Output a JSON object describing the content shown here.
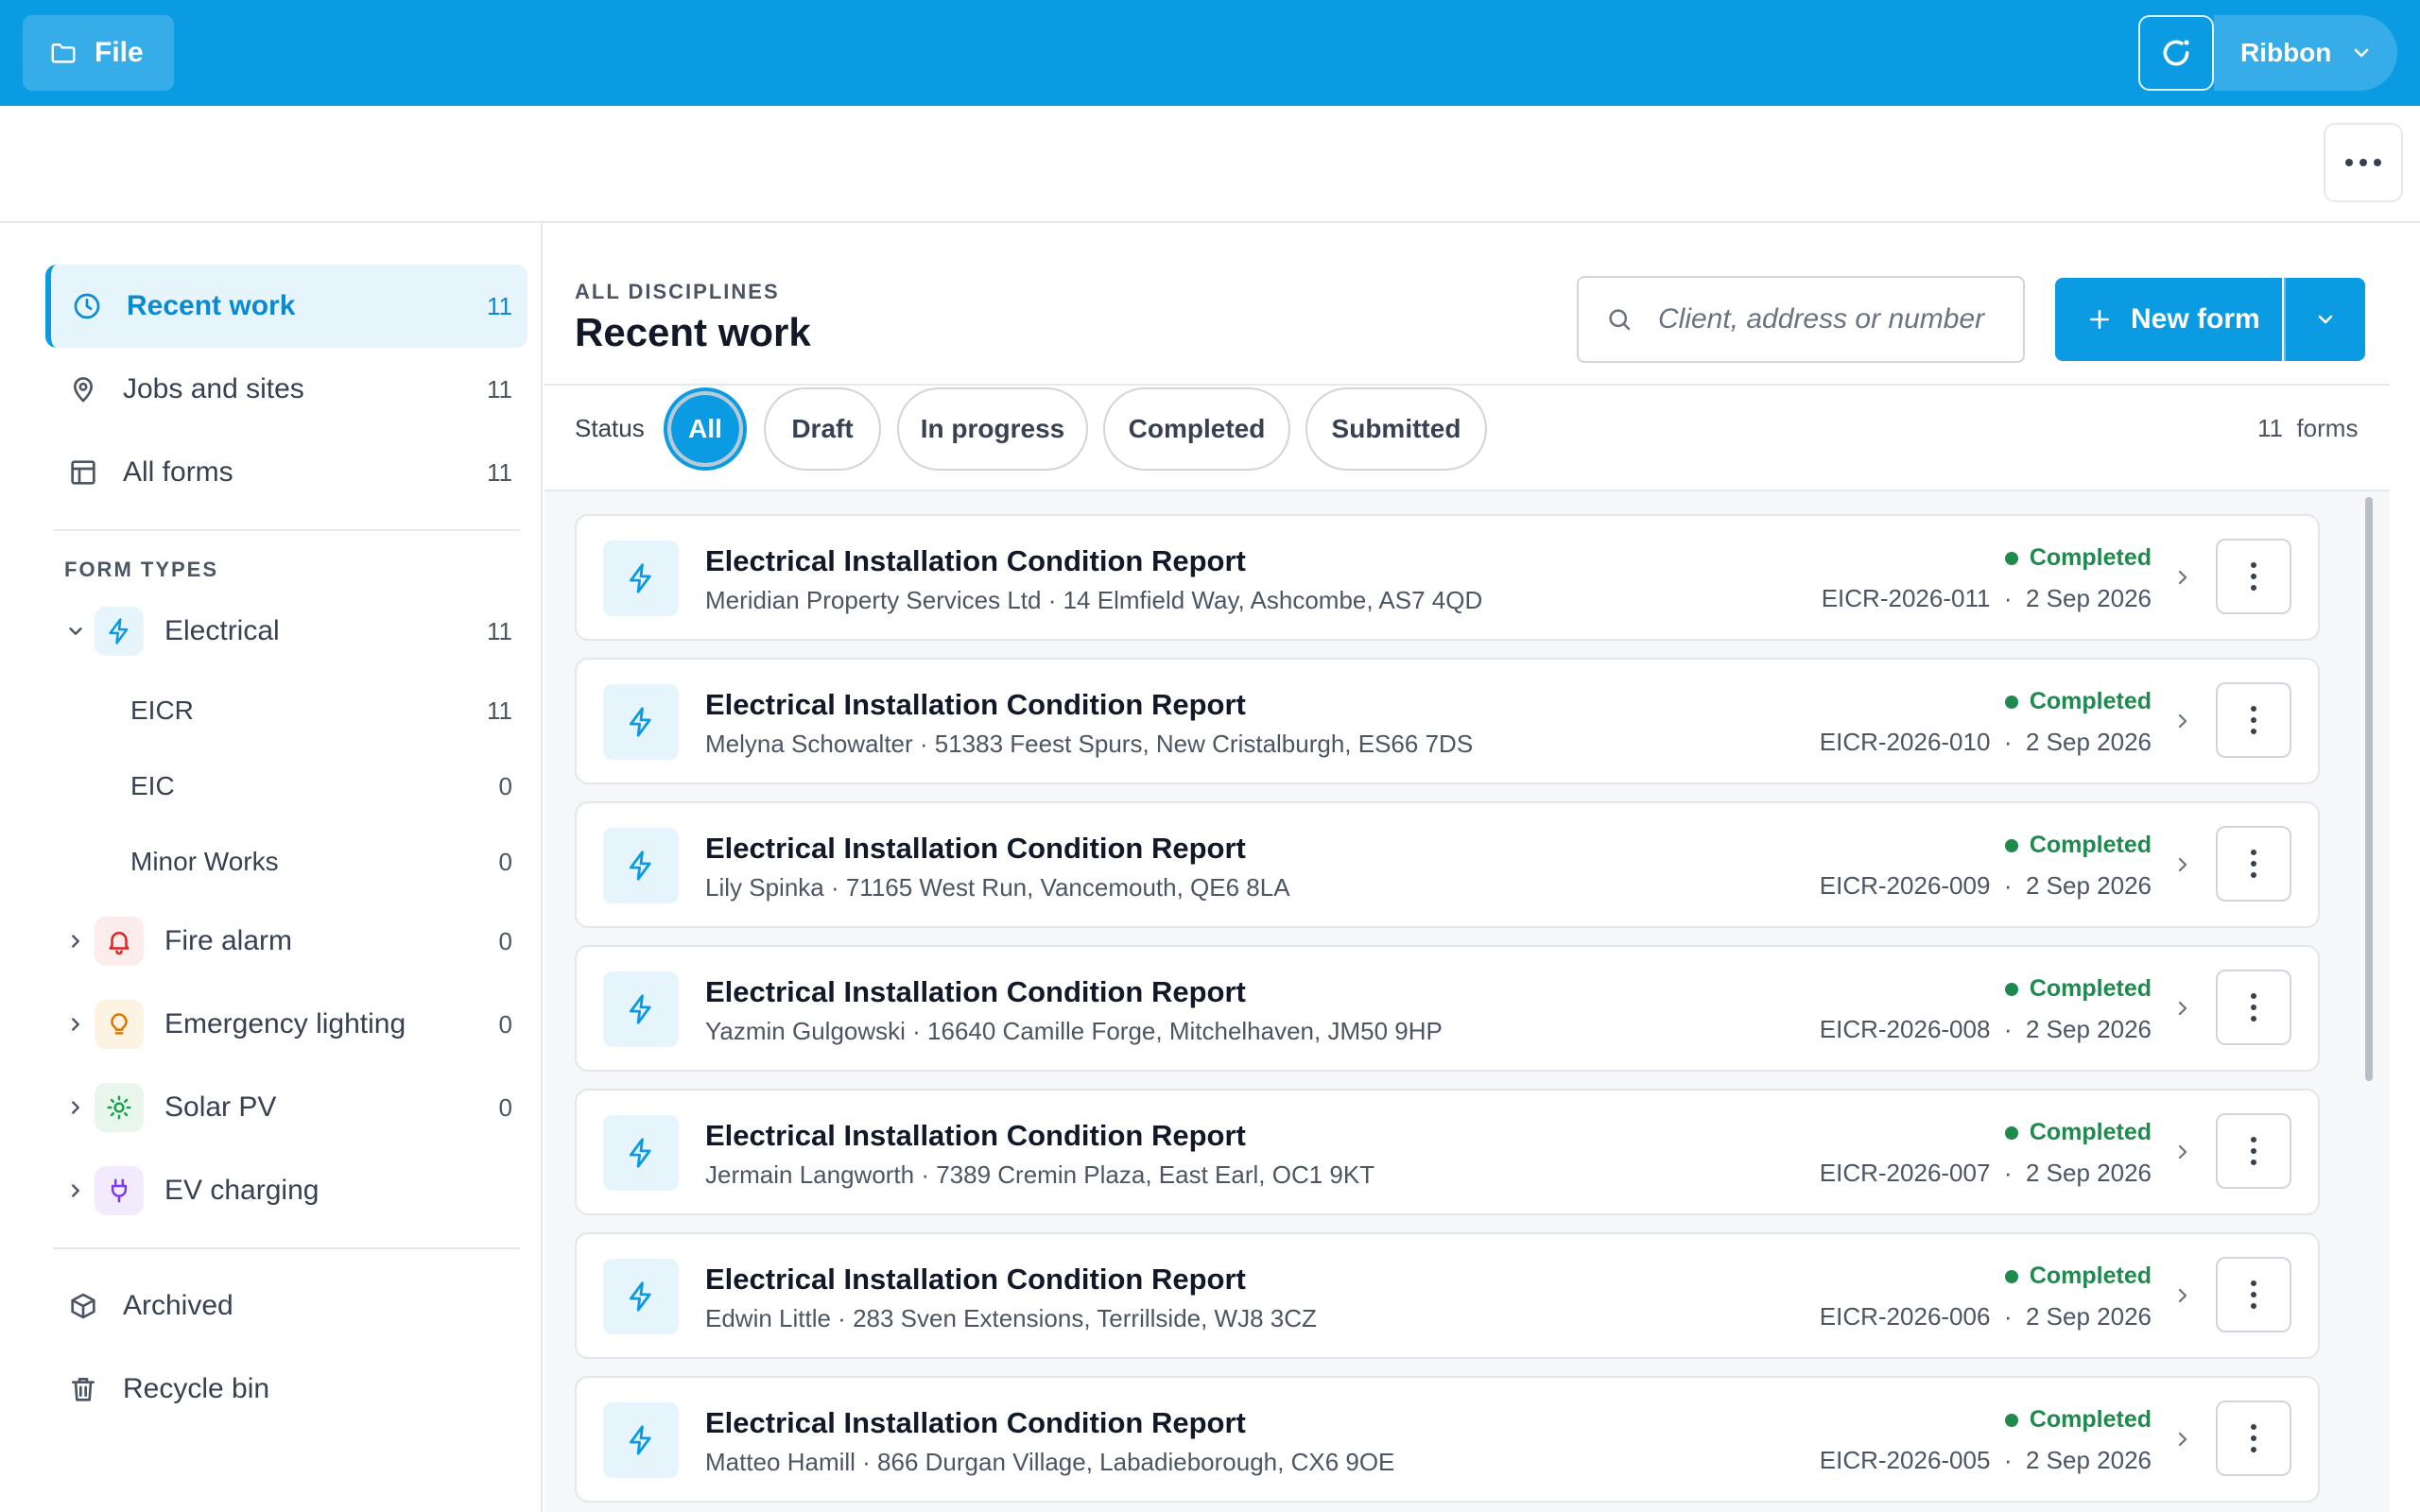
{
  "topbar": {
    "file_label": "File",
    "ribbon_label": "Ribbon",
    "file_icon": "folder-icon",
    "sync_icon": "sync-icon",
    "ribbon_chevron_icon": "chevron-down-icon"
  },
  "sidebar": {
    "nav": [
      {
        "label": "Recent work",
        "count": "11",
        "icon": "clock-icon",
        "active": true
      },
      {
        "label": "Jobs and sites",
        "count": "11",
        "icon": "map-pin-icon"
      },
      {
        "label": "All forms",
        "count": "11",
        "icon": "table-icon"
      }
    ],
    "form_types_title": "FORM TYPES",
    "types": [
      {
        "label": "Electrical",
        "count": "11",
        "icon": "lightning-icon",
        "expanded": true,
        "children": [
          {
            "label": "EICR",
            "count": "11"
          },
          {
            "label": "EIC",
            "count": "0"
          },
          {
            "label": "Minor Works",
            "count": "0"
          }
        ]
      },
      {
        "label": "Fire alarm",
        "count": "0",
        "icon": "bell-icon"
      },
      {
        "label": "Emergency lighting",
        "count": "0",
        "icon": "lightbulb-icon"
      },
      {
        "label": "Solar PV",
        "count": "0",
        "icon": "sun-icon"
      },
      {
        "label": "EV charging",
        "count": "",
        "icon": "plug-icon"
      }
    ],
    "bottom": [
      {
        "label": "Archived",
        "icon": "box-icon"
      },
      {
        "label": "Recycle bin",
        "icon": "trash-icon"
      }
    ]
  },
  "main": {
    "eyebrow": "ALL DISCIPLINES",
    "title": "Recent work",
    "search_placeholder": "Client, address or number",
    "new_form_label": "New form",
    "status_label": "Status",
    "filters": [
      "All",
      "Draft",
      "In progress",
      "Completed",
      "Submitted"
    ],
    "active_filter": "All",
    "forms_count": "11  forms",
    "forms": [
      {
        "title": "Electrical Installation Condition Report",
        "subtitle": "Meridian Property Services Ltd · 14 Elmfield Way, Ashcombe, AS7 4QD",
        "status": "Completed",
        "meta": "EICR-2026-011  ·  2 Sep 2026"
      },
      {
        "title": "Electrical Installation Condition Report",
        "subtitle": "Melyna Schowalter · 51383 Feest Spurs, New Cristalburgh, ES66 7DS",
        "status": "Completed",
        "meta": "EICR-2026-010  ·  2 Sep 2026"
      },
      {
        "title": "Electrical Installation Condition Report",
        "subtitle": "Lily Spinka · 71165 West Run, Vancemouth, QE6 8LA",
        "status": "Completed",
        "meta": "EICR-2026-009  ·  2 Sep 2026"
      },
      {
        "title": "Electrical Installation Condition Report",
        "subtitle": "Yazmin Gulgowski · 16640 Camille Forge, Mitchelhaven, JM50 9HP",
        "status": "Completed",
        "meta": "EICR-2026-008  ·  2 Sep 2026"
      },
      {
        "title": "Electrical Installation Condition Report",
        "subtitle": "Jermain Langworth · 7389 Cremin Plaza, East Earl, OC1 9KT",
        "status": "Completed",
        "meta": "EICR-2026-007  ·  2 Sep 2026"
      },
      {
        "title": "Electrical Installation Condition Report",
        "subtitle": "Edwin Little · 283 Sven Extensions, Terrillside, WJ8 3CZ",
        "status": "Completed",
        "meta": "EICR-2026-006  ·  2 Sep 2026"
      },
      {
        "title": "Electrical Installation Condition Report",
        "subtitle": "Matteo Hamill · 866 Durgan Village, Labadieborough, CX6 9OE",
        "status": "Completed",
        "meta": "EICR-2026-005  ·  2 Sep 2026"
      }
    ]
  },
  "colors": {
    "accent": "#0a9be3",
    "completed": "#1e8a4d",
    "fire": "#dc2626",
    "emergency": "#d97706",
    "solar": "#16a34a",
    "ev": "#7c3aed"
  }
}
